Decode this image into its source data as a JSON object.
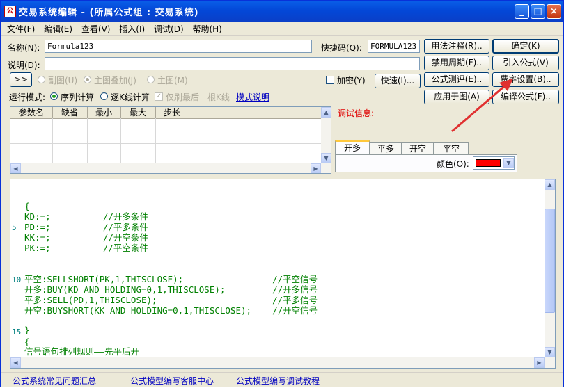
{
  "window": {
    "title": "交易系统编辑 - (所属公式组 : 交易系统)",
    "icon_text": "公"
  },
  "menu": [
    "文件(F)",
    "编辑(E)",
    "查看(V)",
    "插入(I)",
    "调试(D)",
    "帮助(H)"
  ],
  "form": {
    "name_label": "名称(N):",
    "name_value": "Formula123",
    "shortcut_label": "快捷码(Q):",
    "shortcut_value": "FORMULA123",
    "desc_label": "说明(D):",
    "desc_value": ""
  },
  "chart_options": {
    "expand_button": ">>",
    "sub_chart": "副图(U)",
    "main_overlay": "主图叠加(J)",
    "main_chart": "主图(M)",
    "encrypt": "加密(Y)",
    "quick_button": "快速(I)..."
  },
  "run_mode": {
    "label": "运行模式:",
    "sequential": "序列计算",
    "per_bar": "逐K线计算",
    "last_only": "仅刷最后一根K线",
    "help_link": "模式说明"
  },
  "buttons": {
    "usage_note": "用法注释(R)..",
    "ok": "确定(K)",
    "disable_period": "禁用周期(F)..",
    "import": "引入公式(V)",
    "test": "公式测评(E)..",
    "fee": "费率设置(B)..",
    "apply": "应用于图(A)",
    "compile": "编译公式(F).."
  },
  "params": {
    "columns": [
      "参数名",
      "缺省",
      "最小",
      "最大",
      "步长"
    ]
  },
  "debug": {
    "label": "调试信息:"
  },
  "signal_tabs": [
    "开多",
    "平多",
    "开空",
    "平空"
  ],
  "color": {
    "label": "颜色(O):",
    "value": "#ff0000"
  },
  "code": {
    "line_numbers": [
      "5",
      "10",
      "15"
    ],
    "lines": [
      "{",
      "KD:=;          //开多条件",
      "PD:=;          //平多条件",
      "KK:=;          //开空条件",
      "PK:=;          //平空条件",
      "平空:SELLSHORT(PK,1,THISCLOSE);                 //平空信号",
      "开多:BUY(KD AND HOLDING=0,1,THISCLOSE);         //开多信号",
      "平多:SELL(PD,1,THISCLOSE);                      //平多信号",
      "开空:BUYSHORT(KK AND HOLDING=0,1,THISCLOSE);    //开空信号",
      "}",
      "{",
      "信号语句排列规则——先平后开"
    ]
  },
  "footer_links": [
    "公式系统常见问题汇总",
    "公式模型编写客服中心",
    "公式模型编写调试教程"
  ],
  "colors": {
    "accent_arrow": "#e03030",
    "title_bar": "#0348d8"
  }
}
